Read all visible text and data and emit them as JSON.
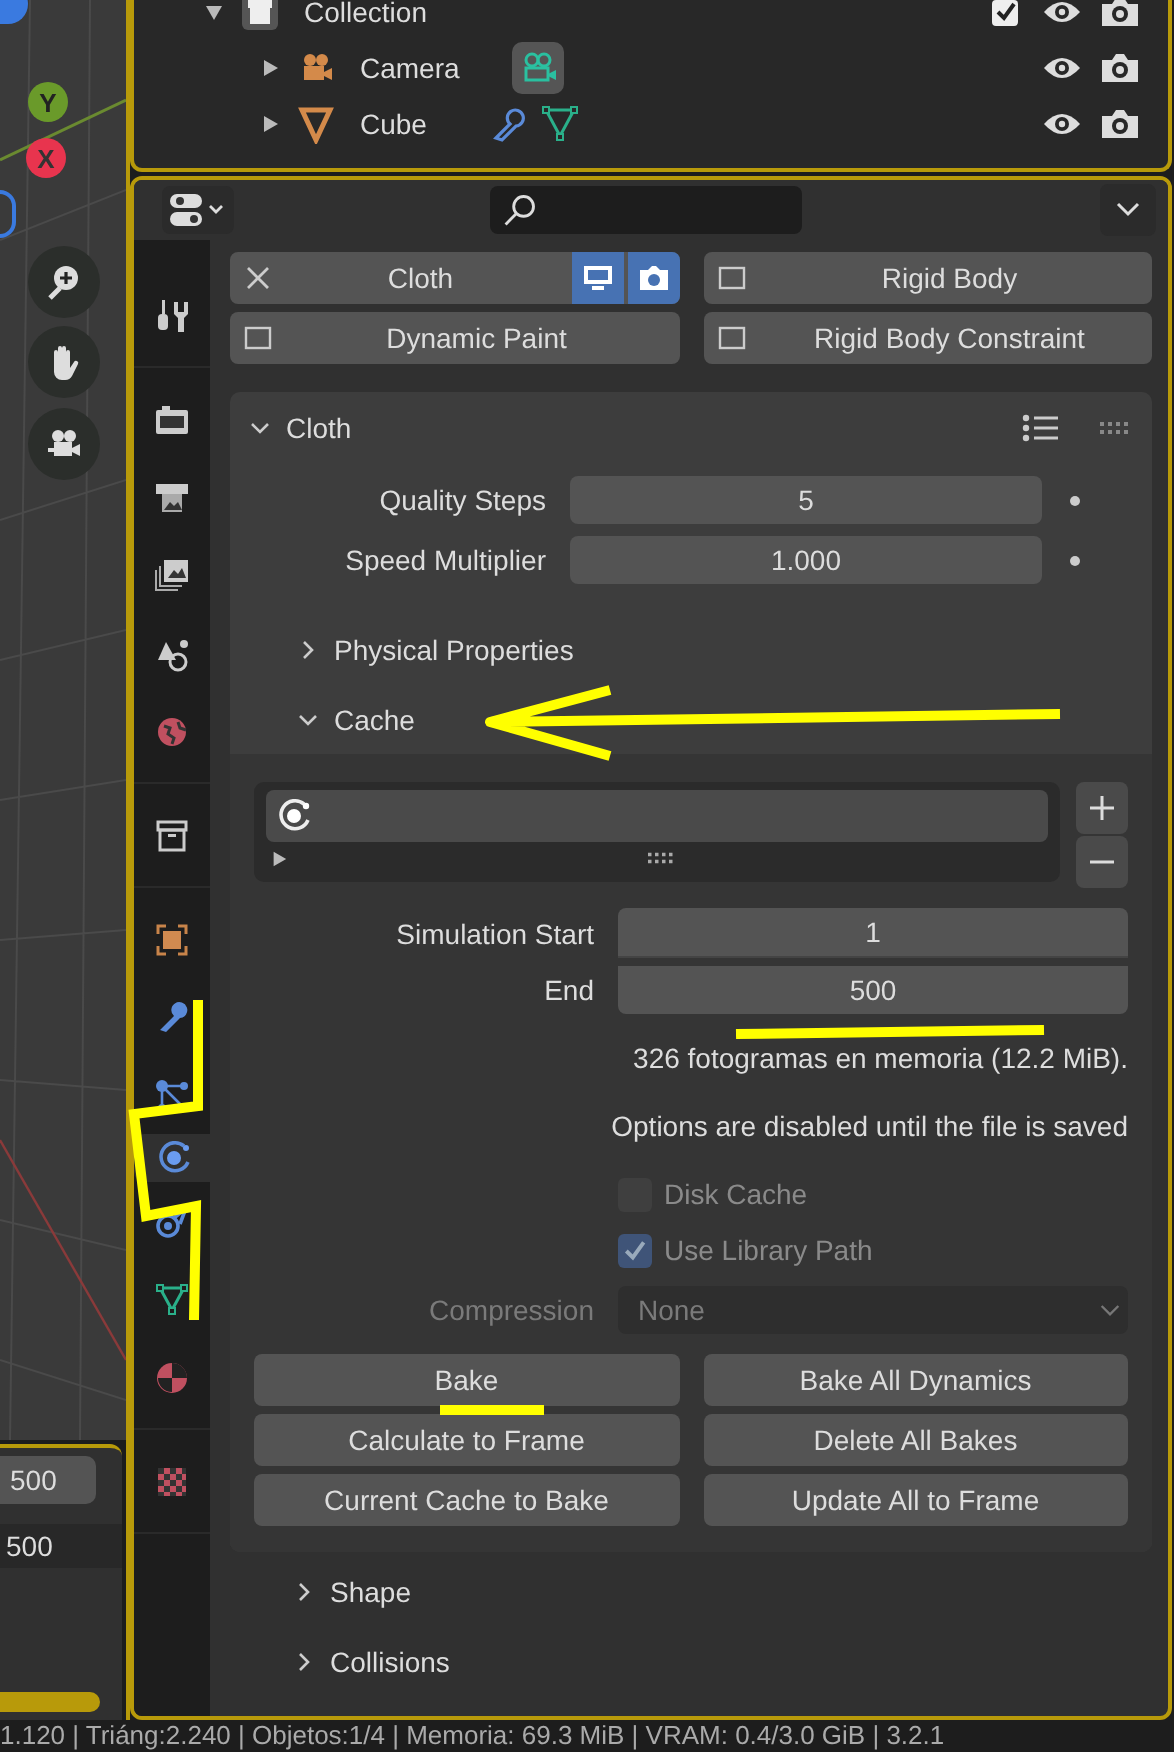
{
  "viewport": {
    "axes": [
      {
        "label": "Y",
        "kind": "y"
      },
      {
        "label": "X",
        "kind": "x"
      }
    ],
    "frame_fields": [
      {
        "value": "500",
        "kind": "field"
      },
      {
        "value": "500",
        "kind": "plain"
      }
    ]
  },
  "outliner": {
    "items": [
      {
        "label": "Collection",
        "kind": "collection",
        "expanded": true,
        "checked": true
      },
      {
        "label": "Camera",
        "kind": "camera",
        "expanded": false
      },
      {
        "label": "Cube",
        "kind": "mesh",
        "expanded": false
      }
    ]
  },
  "properties": {
    "tab_groups": [
      {
        "tabs": [
          {
            "kind": "tool",
            "selected": false
          }
        ]
      },
      {
        "tabs": [
          {
            "kind": "render",
            "selected": false
          },
          {
            "kind": "output",
            "selected": false
          },
          {
            "kind": "view_layer",
            "selected": false
          },
          {
            "kind": "scene",
            "selected": false
          },
          {
            "kind": "world",
            "selected": false
          }
        ]
      },
      {
        "tabs": [
          {
            "kind": "collection",
            "selected": false
          }
        ]
      },
      {
        "tabs": [
          {
            "kind": "object",
            "selected": false
          },
          {
            "kind": "modifiers",
            "selected": false
          },
          {
            "kind": "particles",
            "selected": false
          },
          {
            "kind": "physics",
            "selected": true
          },
          {
            "kind": "constraints",
            "selected": false
          },
          {
            "kind": "data",
            "selected": false
          },
          {
            "kind": "material",
            "selected": false
          }
        ]
      },
      {
        "tabs": [
          {
            "kind": "texture",
            "selected": false
          }
        ]
      }
    ],
    "physics_buttons": [
      {
        "label": "Cloth",
        "enabled": true
      },
      {
        "label": "Rigid Body",
        "enabled": false
      },
      {
        "label": "Dynamic Paint",
        "enabled": false
      },
      {
        "label": "Rigid Body Constraint",
        "enabled": false
      }
    ],
    "panel": {
      "title": "Cloth",
      "expanded": true,
      "fields": [
        {
          "label": "Quality Steps",
          "value": "5"
        },
        {
          "label": "Speed Multiplier",
          "value": "1.000"
        }
      ],
      "subpanels": [
        {
          "label": "Physical Properties",
          "expanded": false
        },
        {
          "label": "Cache",
          "expanded": true
        }
      ],
      "cache": {
        "fields": [
          {
            "label": "Simulation Start",
            "value": "1"
          },
          {
            "label": "End",
            "value": "500"
          }
        ],
        "info": [
          "326 fotogramas en memoria (12.2 MiB).",
          "Options are disabled until the file is saved"
        ],
        "checkboxes": [
          {
            "label": "Disk Cache",
            "checked": false
          },
          {
            "label": "Use Library Path",
            "checked": true
          }
        ],
        "compression": {
          "label": "Compression",
          "value": "None"
        },
        "buttons": [
          "Bake",
          "Bake All Dynamics",
          "Calculate to Frame",
          "Delete All Bakes",
          "Current Cache to Bake",
          "Update All to Frame"
        ]
      }
    },
    "closed_panels": [
      {
        "label": "Shape",
        "expanded": false
      },
      {
        "label": "Collisions",
        "expanded": false
      }
    ]
  },
  "annotations": [
    {
      "kind": "arrow"
    },
    {
      "kind": "underline_end"
    },
    {
      "kind": "underline_bake"
    },
    {
      "kind": "zigzag"
    }
  ],
  "status_bar": "1.120 | Triáng:2.240 | Objetos:1/4 | Memoria: 69.3 MiB | VRAM: 0.4/3.0 GiB | 3.2.1"
}
